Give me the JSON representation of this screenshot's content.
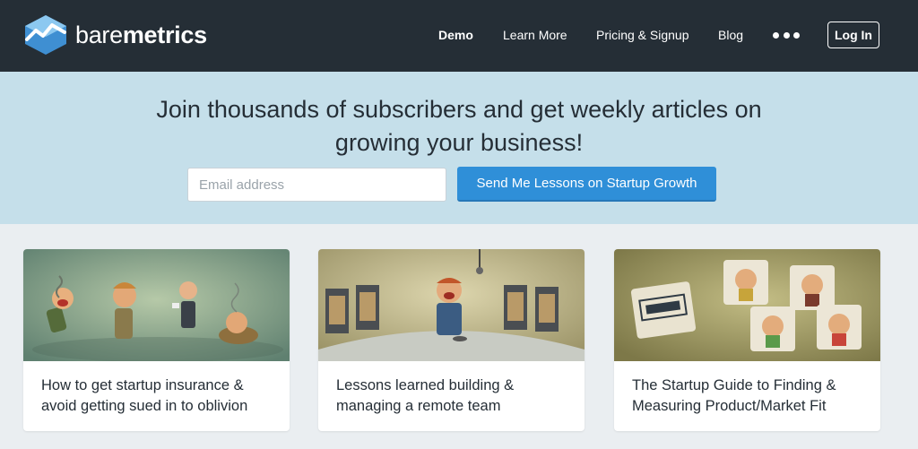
{
  "brand": {
    "name_light": "bare",
    "name_bold": "metrics"
  },
  "nav": {
    "links": [
      "Demo",
      "Learn More",
      "Pricing & Signup",
      "Blog"
    ],
    "more_icon": "ellipsis-icon",
    "login_label": "Log In"
  },
  "hero": {
    "headline_line1": "Join thousands of subscribers and get weekly articles on",
    "headline_line2": "growing your business!",
    "email_placeholder": "Email address",
    "cta_label": "Send Me Lessons on Startup Growth"
  },
  "articles": [
    {
      "title_line1": "How to get startup insurance &",
      "title_line2": "avoid getting sued in to oblivion"
    },
    {
      "title_line1": "Lessons learned building &",
      "title_line2": "managing a remote team"
    },
    {
      "title_line1": "The Startup Guide to Finding &",
      "title_line2": "Measuring Product/Market Fit"
    }
  ],
  "colors": {
    "nav_bg": "#252e36",
    "hero_bg": "#c5dfea",
    "cta_blue": "#2f8fd8",
    "page_bg": "#eaeef1"
  }
}
